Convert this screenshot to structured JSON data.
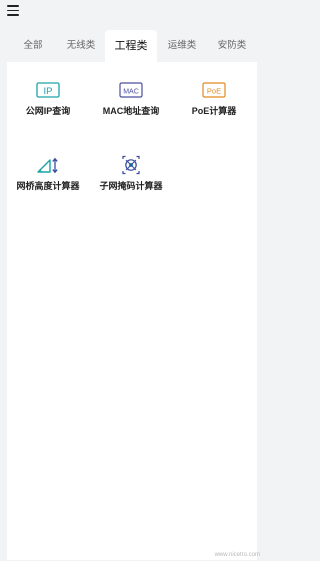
{
  "header": {
    "menu_icon": "hamburger-menu-icon"
  },
  "tabs": [
    {
      "label": "全部",
      "active": false
    },
    {
      "label": "无线类",
      "active": false
    },
    {
      "label": "工程类",
      "active": true
    },
    {
      "label": "运维类",
      "active": false
    },
    {
      "label": "安防类",
      "active": false
    }
  ],
  "tools": [
    {
      "label": "公网IP查询",
      "icon": "ip-icon",
      "icon_text": "IP",
      "color": "#1aa3a8"
    },
    {
      "label": "MAC地址查询",
      "icon": "mac-icon",
      "icon_text": "MAC",
      "color": "#4b4f9e"
    },
    {
      "label": "PoE计算器",
      "icon": "poe-icon",
      "icon_text": "PoE",
      "color": "#e08a1e"
    },
    {
      "label": "网桥高度计算器",
      "icon": "bridge-height-icon",
      "color": "#1aa3a8"
    },
    {
      "label": "子网掩码计算器",
      "icon": "subnet-mask-icon",
      "color": "#3a4a9e"
    }
  ],
  "watermark": "www.nicetro.com"
}
